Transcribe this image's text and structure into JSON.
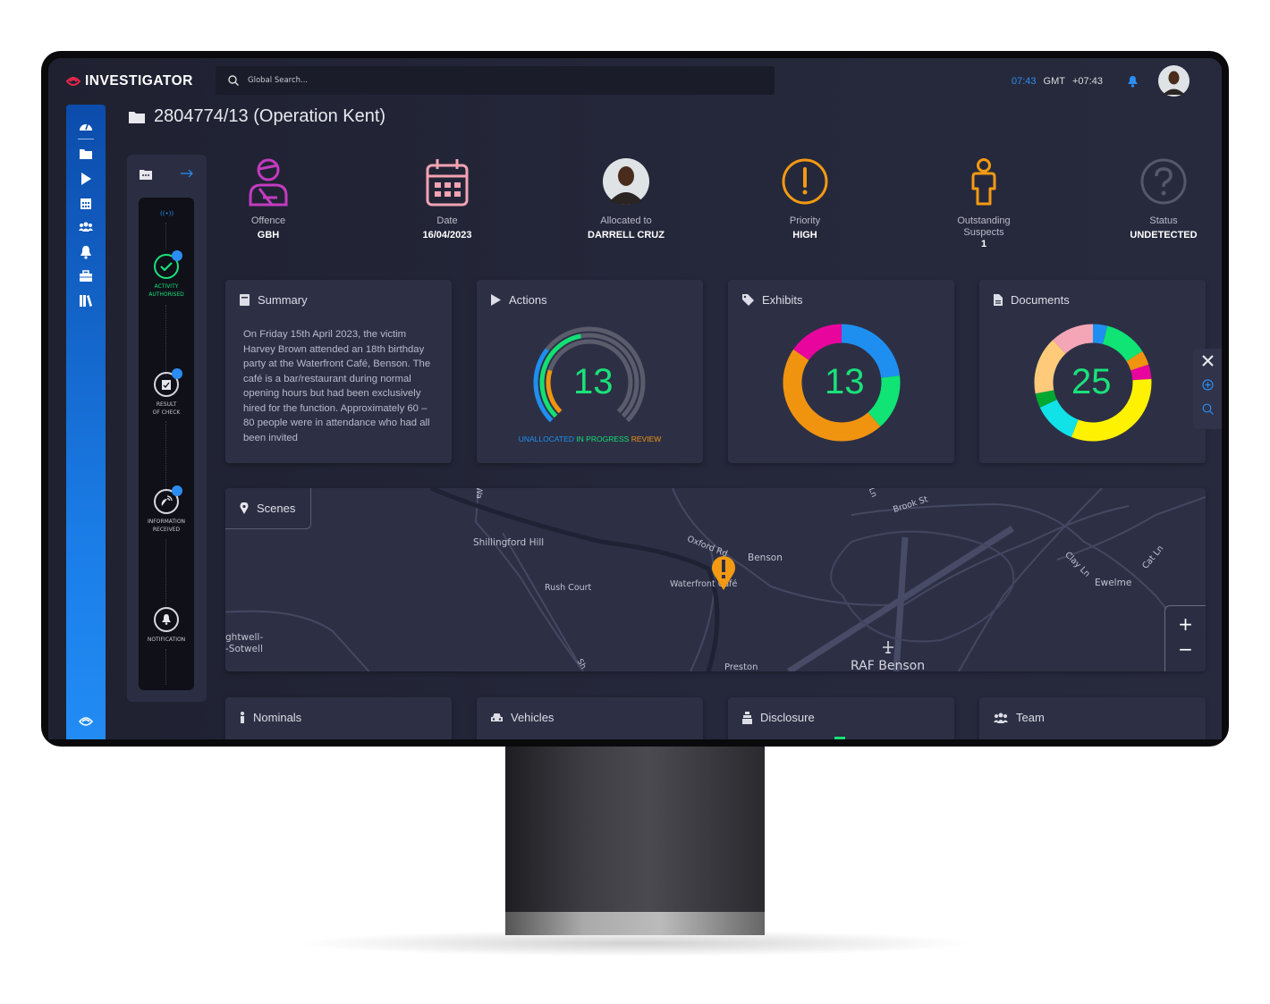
{
  "app": {
    "name": "INVESTIGATOR",
    "brand_color": "#e8264a",
    "accent": "#2b8df2"
  },
  "header": {
    "search_placeholder": "Global Search...",
    "time": "07:43",
    "timezone": "GMT",
    "offset": "+07:43"
  },
  "sidebar": {
    "items": [
      "dashboard-icon",
      "folder-icon",
      "play-icon",
      "calendar-icon",
      "users-icon",
      "bell-icon",
      "briefcase-icon",
      "library-icon"
    ],
    "footer": "eye-logo-icon"
  },
  "case": {
    "title": "2804774/13 (Operation Kent)"
  },
  "timeline": {
    "nodes": [
      {
        "label1": "ACTIVITY",
        "label2": "AUTHORISED",
        "active": true
      },
      {
        "label1": "RESULT",
        "label2": "OF CHECK"
      },
      {
        "label1": "INFORMATION",
        "label2": "RECEIVED"
      },
      {
        "label1": "NOTIFICATION",
        "label2": ""
      }
    ]
  },
  "info": [
    {
      "label": "Offence",
      "value": "GBH",
      "color": "#c43bc0"
    },
    {
      "label": "Date",
      "value": "16/04/2023",
      "color": "#f4a3b3"
    },
    {
      "label": "Allocated to",
      "value": "DARRELL CRUZ"
    },
    {
      "label": "Priority",
      "value": "HIGH",
      "color": "#f49a12"
    },
    {
      "label": "Outstanding",
      "label2": "Suspects",
      "value": "1",
      "color": "#f49a12"
    },
    {
      "label": "Status",
      "value": "UNDETECTED",
      "color": "#55586a"
    }
  ],
  "summary": {
    "title": "Summary",
    "text": "On Friday 15th April 2023, the victim Harvey Brown attended an 18th birthday party at the Waterfront Café, Benson. The café is a bar/restaurant during normal opening hours but had been exclusively hired for the function. Approximately 60 – 80 people were in attendance who had all been invited"
  },
  "actions": {
    "title": "Actions",
    "total": "13",
    "series": [
      {
        "name": "UNALLOCATED",
        "value": 4,
        "color": "#1e8ff0"
      },
      {
        "name": "IN PROGRESS",
        "value": 6,
        "color": "#13e074"
      },
      {
        "name": "REVIEW",
        "value": 3,
        "color": "#f09410"
      }
    ]
  },
  "exhibits": {
    "title": "Exhibits",
    "total": "13",
    "segments": [
      {
        "value": 3,
        "color": "#1e8ff0"
      },
      {
        "value": 2,
        "color": "#10e474"
      },
      {
        "value": 6,
        "color": "#f09410"
      },
      {
        "value": 2,
        "color": "#e8059e"
      }
    ]
  },
  "documents": {
    "title": "Documents",
    "total": "25",
    "segments": [
      {
        "value": 1,
        "color": "#1e8ff0"
      },
      {
        "value": 3,
        "color": "#10e474"
      },
      {
        "value": 1,
        "color": "#f09410"
      },
      {
        "value": 1,
        "color": "#e8059e"
      },
      {
        "value": 8,
        "color": "#fff200"
      },
      {
        "value": 3,
        "color": "#10e2e8"
      },
      {
        "value": 1,
        "color": "#00a832"
      },
      {
        "value": 4,
        "color": "#ffcb7a"
      },
      {
        "value": 3,
        "color": "#f4a6b6"
      }
    ]
  },
  "scenes": {
    "title": "Scenes",
    "labels": [
      "Shillingford Hill",
      "Rush Court",
      "Waterfront Café",
      "Oxford Rd",
      "Benson",
      "Brook St",
      "Clay Ln",
      "Cat Ln",
      "Ewelme",
      "RAF Benson",
      "Preston",
      "ghtwell-",
      "-Sotwell",
      "Wa",
      "Ln",
      "Sh"
    ],
    "zoom_in": "+",
    "zoom_out": "−"
  },
  "bottom_cards": [
    {
      "title": "Nominals"
    },
    {
      "title": "Vehicles"
    },
    {
      "title": "Disclosure"
    },
    {
      "title": "Team"
    }
  ],
  "tools": [
    "tools-icon",
    "add-circle-icon",
    "search-icon"
  ]
}
